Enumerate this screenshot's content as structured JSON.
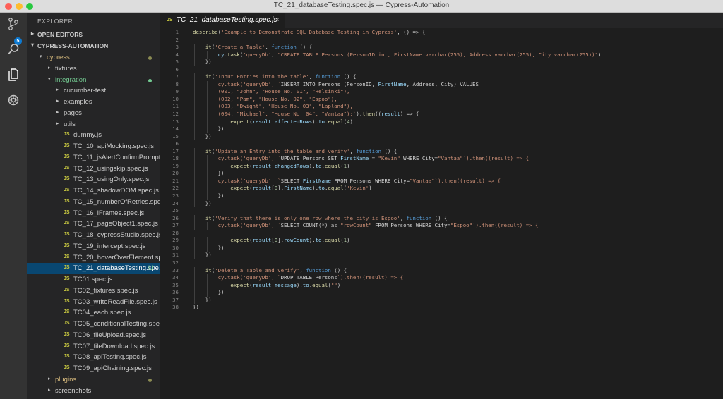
{
  "window": {
    "title": "TC_21_databaseTesting.spec.js — Cypress-Automation"
  },
  "activity_bar": {
    "icons": [
      "source-control-icon",
      "search-icon",
      "files-icon",
      "debug-icon"
    ],
    "badge": "5"
  },
  "sidebar": {
    "title": "EXPLORER",
    "open_editors": "OPEN EDITORS",
    "project": "CYPRESS-AUTOMATION",
    "items": [
      {
        "label": "cypress",
        "kind": "folder-open",
        "depth": 1,
        "status": "dot-yellow",
        "color": "yellow"
      },
      {
        "label": "fixtures",
        "kind": "folder",
        "depth": 2
      },
      {
        "label": "integration",
        "kind": "folder-open",
        "depth": 2,
        "status": "dot-green",
        "color": "green"
      },
      {
        "label": "cucumber-test",
        "kind": "folder",
        "depth": 3
      },
      {
        "label": "examples",
        "kind": "folder",
        "depth": 3
      },
      {
        "label": "pages",
        "kind": "folder",
        "depth": 3
      },
      {
        "label": "utils",
        "kind": "folder",
        "depth": 3
      },
      {
        "label": "dummy.js",
        "kind": "file",
        "depth": 3
      },
      {
        "label": "TC_10_apiMocking.spec.js",
        "kind": "file",
        "depth": 3
      },
      {
        "label": "TC_11_jsAlertConfirmPrompt.sp...",
        "kind": "file",
        "depth": 3
      },
      {
        "label": "TC_12_usingskip.spec.js",
        "kind": "file",
        "depth": 3
      },
      {
        "label": "TC_13_usingOnly.spec.js",
        "kind": "file",
        "depth": 3
      },
      {
        "label": "TC_14_shadowDOM.spec.js",
        "kind": "file",
        "depth": 3
      },
      {
        "label": "TC_15_numberOfRetries.spec.js",
        "kind": "file",
        "depth": 3
      },
      {
        "label": "TC_16_iFrames.spec.js",
        "kind": "file",
        "depth": 3
      },
      {
        "label": "TC_17_pageObject1.spec.js",
        "kind": "file",
        "depth": 3
      },
      {
        "label": "TC_18_cypressStudio.spec.js",
        "kind": "file",
        "depth": 3
      },
      {
        "label": "TC_19_intercept.spec.js",
        "kind": "file",
        "depth": 3
      },
      {
        "label": "TC_20_hoverOverElement.spec...",
        "kind": "file",
        "depth": 3
      },
      {
        "label": "TC_21_databaseTesting.spe...",
        "kind": "file",
        "depth": 3,
        "selected": true,
        "status": "U"
      },
      {
        "label": "TC01.spec.js",
        "kind": "file",
        "depth": 3
      },
      {
        "label": "TC02_fixtures.spec.js",
        "kind": "file",
        "depth": 3
      },
      {
        "label": "TC03_writeReadFile.spec.js",
        "kind": "file",
        "depth": 3
      },
      {
        "label": "TC04_each.spec.js",
        "kind": "file",
        "depth": 3
      },
      {
        "label": "TC05_conditionalTesting.spec.js",
        "kind": "file",
        "depth": 3
      },
      {
        "label": "TC06_fileUpload.spec.js",
        "kind": "file",
        "depth": 3
      },
      {
        "label": "TC07_fileDownload.spec.js",
        "kind": "file",
        "depth": 3
      },
      {
        "label": "TC08_apiTesting.spec.js",
        "kind": "file",
        "depth": 3
      },
      {
        "label": "TC09_apiChaining.spec.js",
        "kind": "file",
        "depth": 3
      },
      {
        "label": "plugins",
        "kind": "folder",
        "depth": 2,
        "status": "dot-yellow",
        "color": "yellow"
      },
      {
        "label": "screenshots",
        "kind": "folder",
        "depth": 2
      }
    ]
  },
  "editor": {
    "tab": {
      "label": "TC_21_databaseTesting.spec.js",
      "icon": "JS",
      "close": "×"
    },
    "lines": [
      "describe('Example to Demonstrate SQL Database Testing in Cypress', () => {",
      "",
      "    it('Create a Table', function () {",
      "        cy.task('queryDb', \"CREATE TABLE Persons (PersonID int, FirstName varchar(255), Address varchar(255), City varchar(255))\")",
      "    })",
      "",
      "    it('Input Entries into the table', function () {",
      "        cy.task('queryDb', `INSERT INTO Persons (PersonID, FirstName, Address, City) VALUES",
      "        (001, \"John\", \"House No. 01\", \"Helsinki\"),",
      "        (002, \"Pam\", \"House No. 02\", \"Espoo\"),",
      "        (003, \"Dwight\", \"House No. 03\", \"Lapland\"),",
      "        (004, \"Michael\", \"House No. 04\", \"Vantaa\");`).then((result) => {",
      "            expect(result.affectedRows).to.equal(4)",
      "        })",
      "    })",
      "",
      "    it('Update an Entry into the table and verify', function () {",
      "        cy.task('queryDb', `UPDATE Persons SET FirstName = \"Kevin\" WHERE City=\"Vantaa\"`).then((result) => {",
      "            expect(result.changedRows).to.equal(1)",
      "        })",
      "        cy.task('queryDb', `SELECT FirstName FROM Persons WHERE City=\"Vantaa\"`).then((result) => {",
      "            expect(result[0].FirstName).to.equal('Kevin')",
      "        })",
      "    })",
      "",
      "    it('Verify that there is only one row where the city is Espoo', function () {",
      "        cy.task('queryDb', `SELECT COUNT(*) as \"rowCount\" FROM Persons WHERE City=\"Espoo\"`).then((result) => {",
      "",
      "            expect(result[0].rowCount).to.equal(1)",
      "        })",
      "    })",
      "",
      "    it('Delete a Table and Verify', function () {",
      "        cy.task('queryDb', `DROP TABLE Persons`).then((result) => {",
      "            expect(result.message).to.equal(\"\")",
      "        })",
      "    })",
      "})"
    ]
  }
}
